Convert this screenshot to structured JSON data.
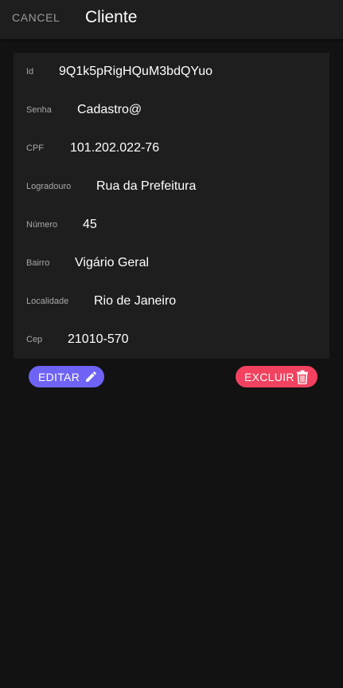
{
  "header": {
    "cancel_label": "CANCEL",
    "title": "Cliente"
  },
  "fields": [
    {
      "label": "Id",
      "value": "9Q1k5pRigHQuM3bdQYuo"
    },
    {
      "label": "Senha",
      "value": "Cadastro@"
    },
    {
      "label": "CPF",
      "value": "101.202.022-76"
    },
    {
      "label": "Logradouro",
      "value": "Rua da Prefeitura"
    },
    {
      "label": "Número",
      "value": "45"
    },
    {
      "label": "Bairro",
      "value": "Vigário Geral"
    },
    {
      "label": "Localidade",
      "value": "Rio de Janeiro"
    },
    {
      "label": "Cep",
      "value": "21010-570"
    }
  ],
  "actions": {
    "edit_label": "EDITAR",
    "edit_icon": "pencil-icon",
    "delete_label": "EXCLUIR",
    "delete_icon": "trash-icon"
  },
  "colors": {
    "background": "#121212",
    "surface": "#1e1e1e",
    "edit_button": "#6f63f5",
    "delete_button": "#f2425f"
  }
}
